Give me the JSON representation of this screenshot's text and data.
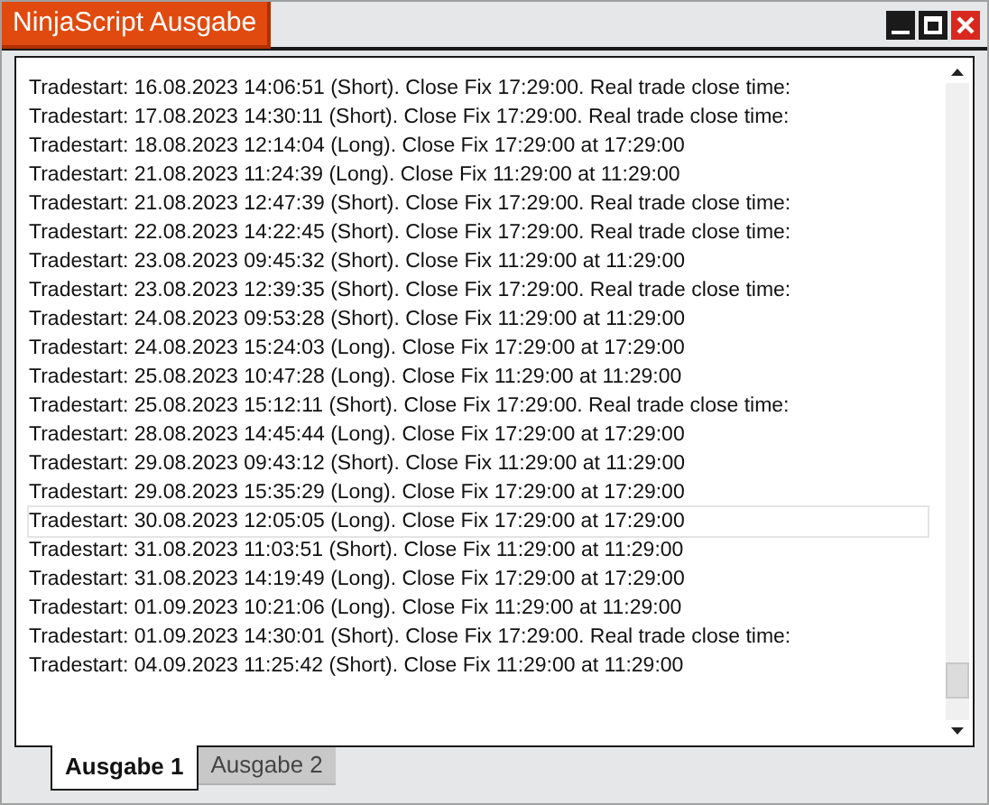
{
  "window": {
    "title": "NinjaScript Ausgabe"
  },
  "lines": [
    {
      "text": "Tradestart: 16.08.2023 14:06:51 (Short). Close Fix 17:29:00. Real trade close time:",
      "current": false
    },
    {
      "text": "Tradestart: 17.08.2023 14:30:11 (Short). Close Fix 17:29:00. Real trade close time:",
      "current": false
    },
    {
      "text": "Tradestart: 18.08.2023 12:14:04 (Long). Close Fix 17:29:00 at 17:29:00",
      "current": false
    },
    {
      "text": "Tradestart: 21.08.2023 11:24:39 (Long). Close Fix 11:29:00 at 11:29:00",
      "current": false
    },
    {
      "text": "Tradestart: 21.08.2023 12:47:39 (Short). Close Fix 17:29:00. Real trade close time:",
      "current": false
    },
    {
      "text": "Tradestart: 22.08.2023 14:22:45 (Short). Close Fix 17:29:00. Real trade close time:",
      "current": false
    },
    {
      "text": "Tradestart: 23.08.2023 09:45:32 (Short). Close Fix 11:29:00 at 11:29:00",
      "current": false
    },
    {
      "text": "Tradestart: 23.08.2023 12:39:35 (Short). Close Fix 17:29:00. Real trade close time:",
      "current": false
    },
    {
      "text": "Tradestart: 24.08.2023 09:53:28 (Short). Close Fix 11:29:00 at 11:29:00",
      "current": false
    },
    {
      "text": "Tradestart: 24.08.2023 15:24:03 (Long). Close Fix 17:29:00 at 17:29:00",
      "current": false
    },
    {
      "text": "Tradestart: 25.08.2023 10:47:28 (Long). Close Fix 11:29:00 at 11:29:00",
      "current": false
    },
    {
      "text": "Tradestart: 25.08.2023 15:12:11 (Short). Close Fix 17:29:00. Real trade close time:",
      "current": false
    },
    {
      "text": "Tradestart: 28.08.2023 14:45:44 (Long). Close Fix 17:29:00 at 17:29:00",
      "current": false
    },
    {
      "text": "Tradestart: 29.08.2023 09:43:12 (Short). Close Fix 11:29:00 at 11:29:00",
      "current": false
    },
    {
      "text": "Tradestart: 29.08.2023 15:35:29 (Long). Close Fix 17:29:00 at 17:29:00",
      "current": false
    },
    {
      "text": "Tradestart: 30.08.2023 12:05:05 (Long). Close Fix 17:29:00 at 17:29:00",
      "current": true
    },
    {
      "text": "Tradestart: 31.08.2023 11:03:51 (Short). Close Fix 11:29:00 at 11:29:00",
      "current": false
    },
    {
      "text": "Tradestart: 31.08.2023 14:19:49 (Long). Close Fix 17:29:00 at 17:29:00",
      "current": false
    },
    {
      "text": "Tradestart: 01.09.2023 10:21:06 (Long). Close Fix 11:29:00 at 11:29:00",
      "current": false
    },
    {
      "text": "Tradestart: 01.09.2023 14:30:01 (Short). Close Fix 17:29:00. Real trade close time:",
      "current": false
    },
    {
      "text": "Tradestart: 04.09.2023 11:25:42 (Short). Close Fix 11:29:00 at 11:29:00",
      "current": false
    }
  ],
  "tabs": [
    {
      "label": "Ausgabe 1",
      "selected": true
    },
    {
      "label": "Ausgabe 2",
      "selected": false
    }
  ]
}
